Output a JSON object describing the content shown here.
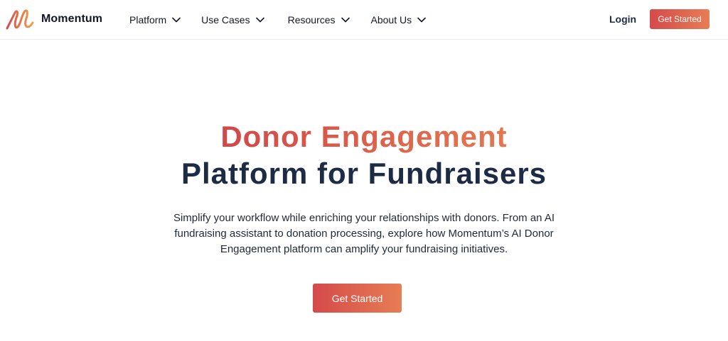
{
  "brand": {
    "name": "Momentum",
    "logo_icon": "momentum-logo-icon"
  },
  "nav": {
    "items": [
      {
        "label": "Platform",
        "icon": "chevron-down-icon"
      },
      {
        "label": "Use Cases",
        "icon": "chevron-down-icon"
      },
      {
        "label": "Resources",
        "icon": "chevron-down-icon"
      },
      {
        "label": "About Us",
        "icon": "chevron-down-icon"
      }
    ],
    "login_label": "Login",
    "cta_label": "Get Started"
  },
  "hero": {
    "title_accent": "Donor Engagement",
    "title_main": "Platform for Fundraisers",
    "description": "Simplify your workflow while enriching your relationships with donors. From an AI fundraising assistant to donation processing, explore how Momentum’s AI Donor Engagement platform can amplify your fundraising initiatives.",
    "cta_label": "Get Started"
  },
  "colors": {
    "accent_start": "#d54a4a",
    "accent_end": "#e77d55",
    "navy": "#1e2b45"
  }
}
